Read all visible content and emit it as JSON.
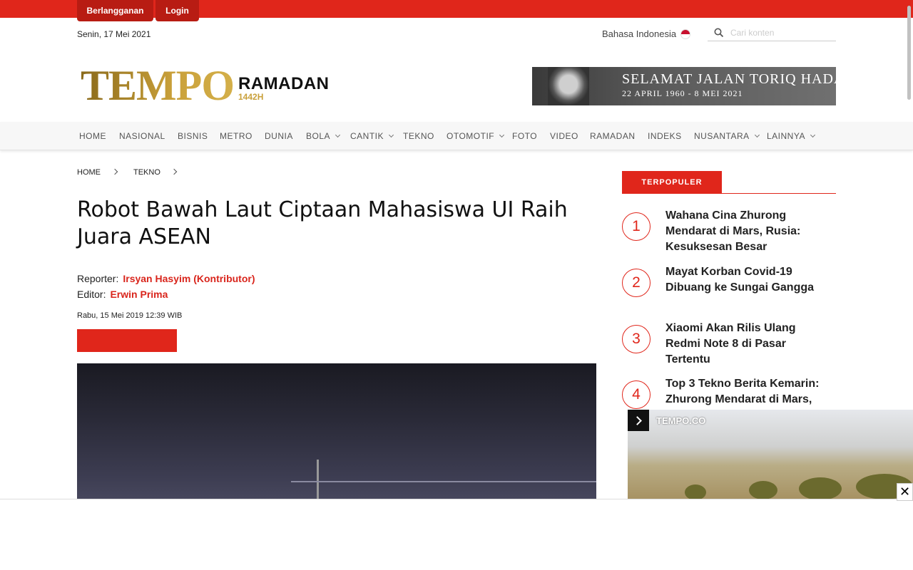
{
  "topbar": {
    "subscribe_label": "Berlangganan",
    "login_label": "Login"
  },
  "header": {
    "date": "Senin, 17 Mei 2021",
    "language": "Bahasa Indonesia",
    "search_placeholder": "Cari konten",
    "logo_main": "TEMPO",
    "logo_sub": "RAMADAN",
    "logo_year": "1442H",
    "banner_line1": "SELAMAT JALAN TORIQ HADAD",
    "banner_line2": "22 APRIL 1960 - 8 MEI 2021"
  },
  "nav": {
    "items": [
      {
        "label": "HOME"
      },
      {
        "label": "NASIONAL"
      },
      {
        "label": "BISNIS"
      },
      {
        "label": "METRO"
      },
      {
        "label": "DUNIA"
      },
      {
        "label": "BOLA"
      },
      {
        "label": "CANTIK"
      },
      {
        "label": "TEKNO"
      },
      {
        "label": "OTOMOTIF"
      },
      {
        "label": "FOTO"
      },
      {
        "label": "VIDEO"
      },
      {
        "label": "RAMADAN"
      },
      {
        "label": "INDEKS"
      },
      {
        "label": "NUSANTARA"
      },
      {
        "label": "LAINNYA"
      }
    ]
  },
  "breadcrumb": {
    "home": "HOME",
    "section": "TEKNO"
  },
  "article": {
    "title": "Robot Bawah Laut Ciptaan Mahasiswa UI Raih Juara ASEAN",
    "reporter_label": "Reporter:",
    "reporter_name": "Irsyan Hasyim (Kontributor)",
    "editor_label": "Editor:",
    "editor_name": "Erwin Prima",
    "published": "Rabu, 15 Mei 2019 12:39 WIB"
  },
  "sidebar": {
    "tab_label": "TERPOPULER",
    "items": [
      {
        "rank": "1",
        "title": "Wahana Cina Zhurong Mendarat di Mars, Rusia: Kesuksesan Besar"
      },
      {
        "rank": "2",
        "title": "Mayat Korban Covid-19 Dibuang ke Sungai Gangga"
      },
      {
        "rank": "3",
        "title": "Xiaomi Akan Rilis Ulang Redmi Note 8 di Pasar Tertentu"
      },
      {
        "rank": "4",
        "title": "Top 3 Tekno Berita Kemarin: Zhurong Mendarat di Mars,"
      }
    ]
  },
  "video": {
    "brand": "TEMPO.CO"
  },
  "colors": {
    "accent": "#e0261b",
    "accent_dark": "#b81c13"
  },
  "icons": {
    "search": "search-icon",
    "next": "chevron-right-icon",
    "close": "close-icon"
  }
}
